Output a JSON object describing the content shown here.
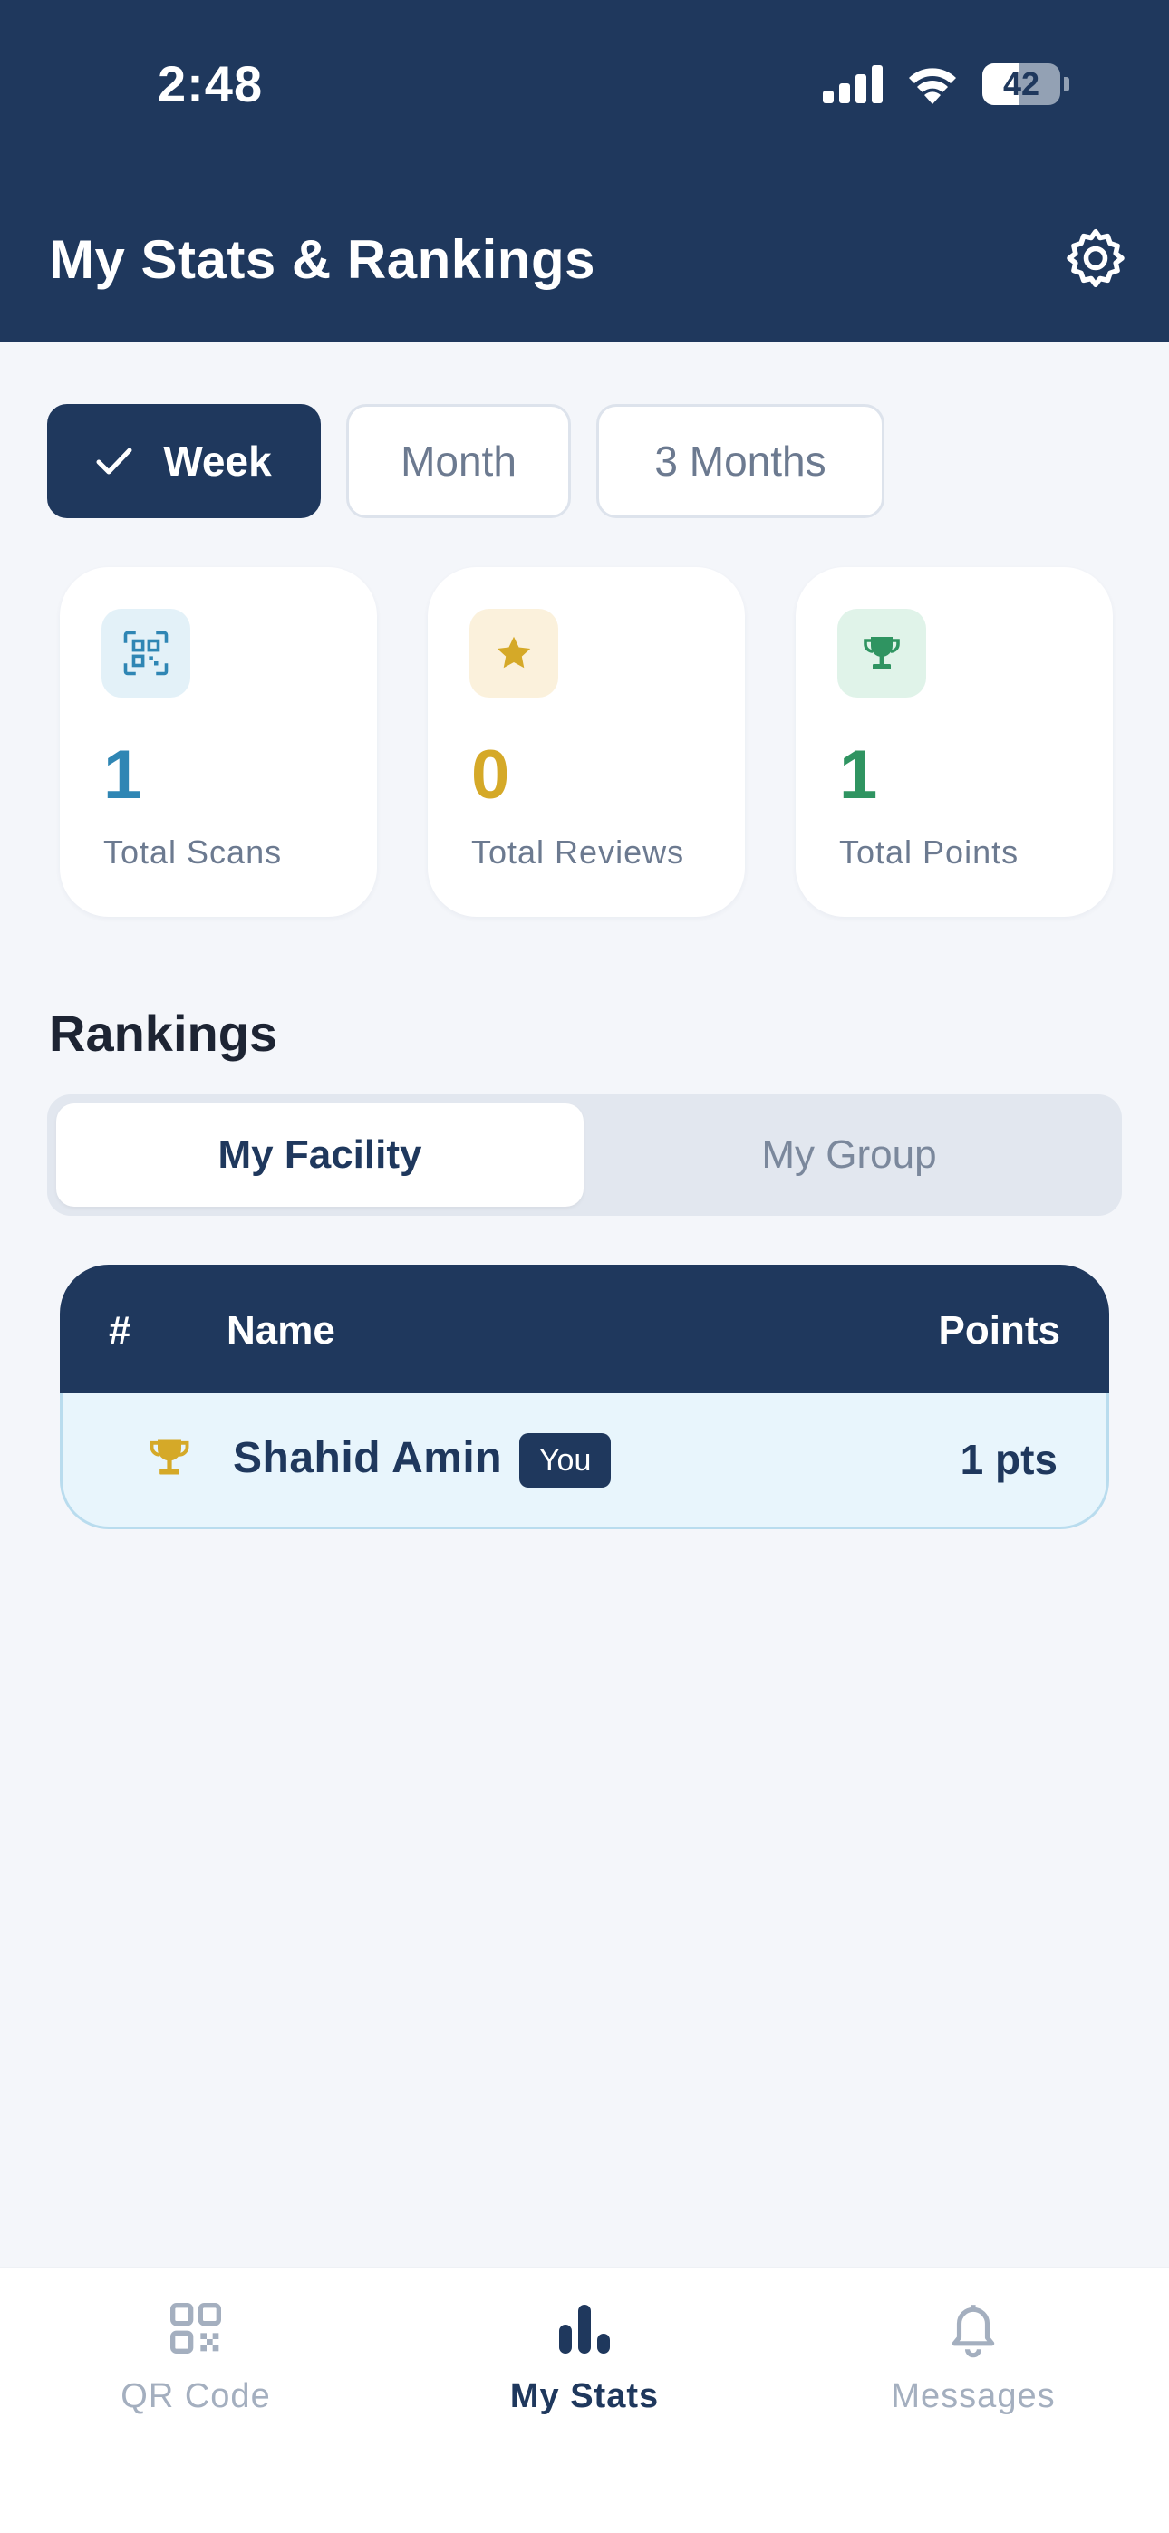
{
  "status_bar": {
    "time": "2:48",
    "battery": "42"
  },
  "header": {
    "title": "My Stats & Rankings",
    "settings_icon": "gear-icon"
  },
  "period_tabs": [
    {
      "label": "Week",
      "selected": true
    },
    {
      "label": "Month",
      "selected": false
    },
    {
      "label": "3 Months",
      "selected": false
    }
  ],
  "stats": [
    {
      "value": "1",
      "label": "Total Scans",
      "icon": "qr-code-icon",
      "color": "#2f86b4"
    },
    {
      "value": "0",
      "label": "Total Reviews",
      "icon": "star-icon",
      "color": "#d5a928"
    },
    {
      "value": "1",
      "label": "Total Points",
      "icon": "trophy-icon",
      "color": "#2f9461"
    }
  ],
  "rankings": {
    "title": "Rankings",
    "segments": [
      {
        "label": "My Facility",
        "selected": true
      },
      {
        "label": "My Group",
        "selected": false
      }
    ],
    "columns": {
      "rank": "#",
      "name": "Name",
      "points": "Points"
    },
    "rows": [
      {
        "rank_icon": "trophy-icon",
        "name": "Shahid Amin",
        "badge": "You",
        "points": "1 pts"
      }
    ]
  },
  "bottom_nav": [
    {
      "label": "QR Code",
      "icon": "qr-code-icon",
      "active": false
    },
    {
      "label": "My Stats",
      "icon": "bar-chart-icon",
      "active": true
    },
    {
      "label": "Messages",
      "icon": "bell-icon",
      "active": false
    }
  ],
  "colors": {
    "primary": "#1f385d",
    "background": "#f4f6fa",
    "highlight_row": "#e8f5fc"
  }
}
